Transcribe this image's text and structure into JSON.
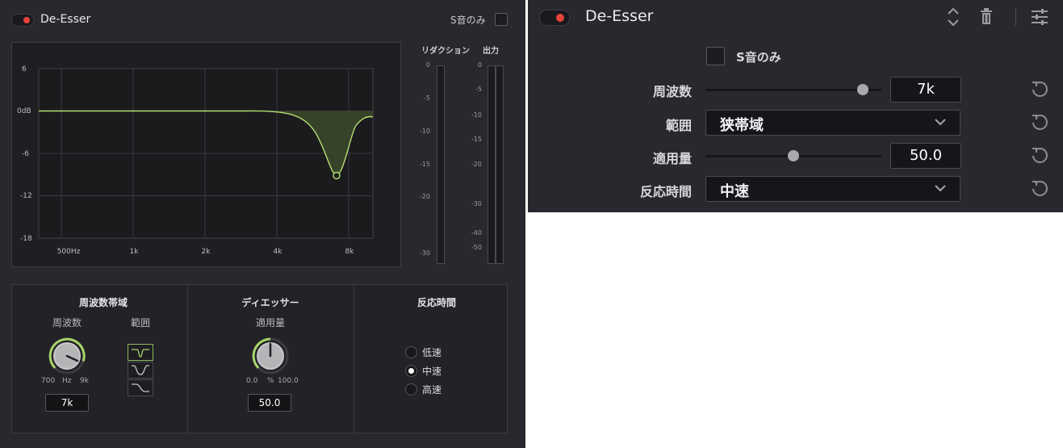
{
  "left": {
    "title": "De-Esser",
    "s_only_label": "S音のみ",
    "graph": {
      "y_labels": [
        "6",
        "0dB",
        "-6",
        "-12",
        "-18"
      ],
      "x_labels": [
        "500Hz",
        "1k",
        "2k",
        "4k",
        "8k"
      ]
    },
    "meters": {
      "reduction_label": "リダクション",
      "output_label": "出力",
      "reduction_ticks": [
        "0",
        "-5",
        "-10",
        "-15",
        "-20",
        "-30"
      ],
      "output_ticks": [
        "0",
        "-5",
        "-10",
        "-15",
        "-20",
        "-30",
        "-40",
        "-50"
      ]
    },
    "freq_section": {
      "title": "周波数帯域",
      "freq_label": "周波数",
      "range_label": "範囲",
      "knob_min": "700",
      "knob_unit": "Hz",
      "knob_max": "9k",
      "value": "7k"
    },
    "deesser_section": {
      "title": "ディエッサー",
      "amount_label": "適用量",
      "knob_min": "0.0",
      "knob_unit": "%",
      "knob_max": "100.0",
      "value": "50.0"
    },
    "response_section": {
      "title": "反応時間",
      "options": [
        "低速",
        "中速",
        "高速"
      ],
      "selected": "中速"
    }
  },
  "right": {
    "title": "De-Esser",
    "s_only_label": "S音のみ",
    "freq_label": "周波数",
    "freq_value": "7k",
    "range_label": "範囲",
    "range_value": "狭帯域",
    "amount_label": "適用量",
    "amount_value": "50.0",
    "response_label": "反応時間",
    "response_value": "中速"
  },
  "colors": {
    "panel_bg": "#28282e",
    "accent_green": "#a7d46a",
    "power_red": "#e8433a"
  }
}
